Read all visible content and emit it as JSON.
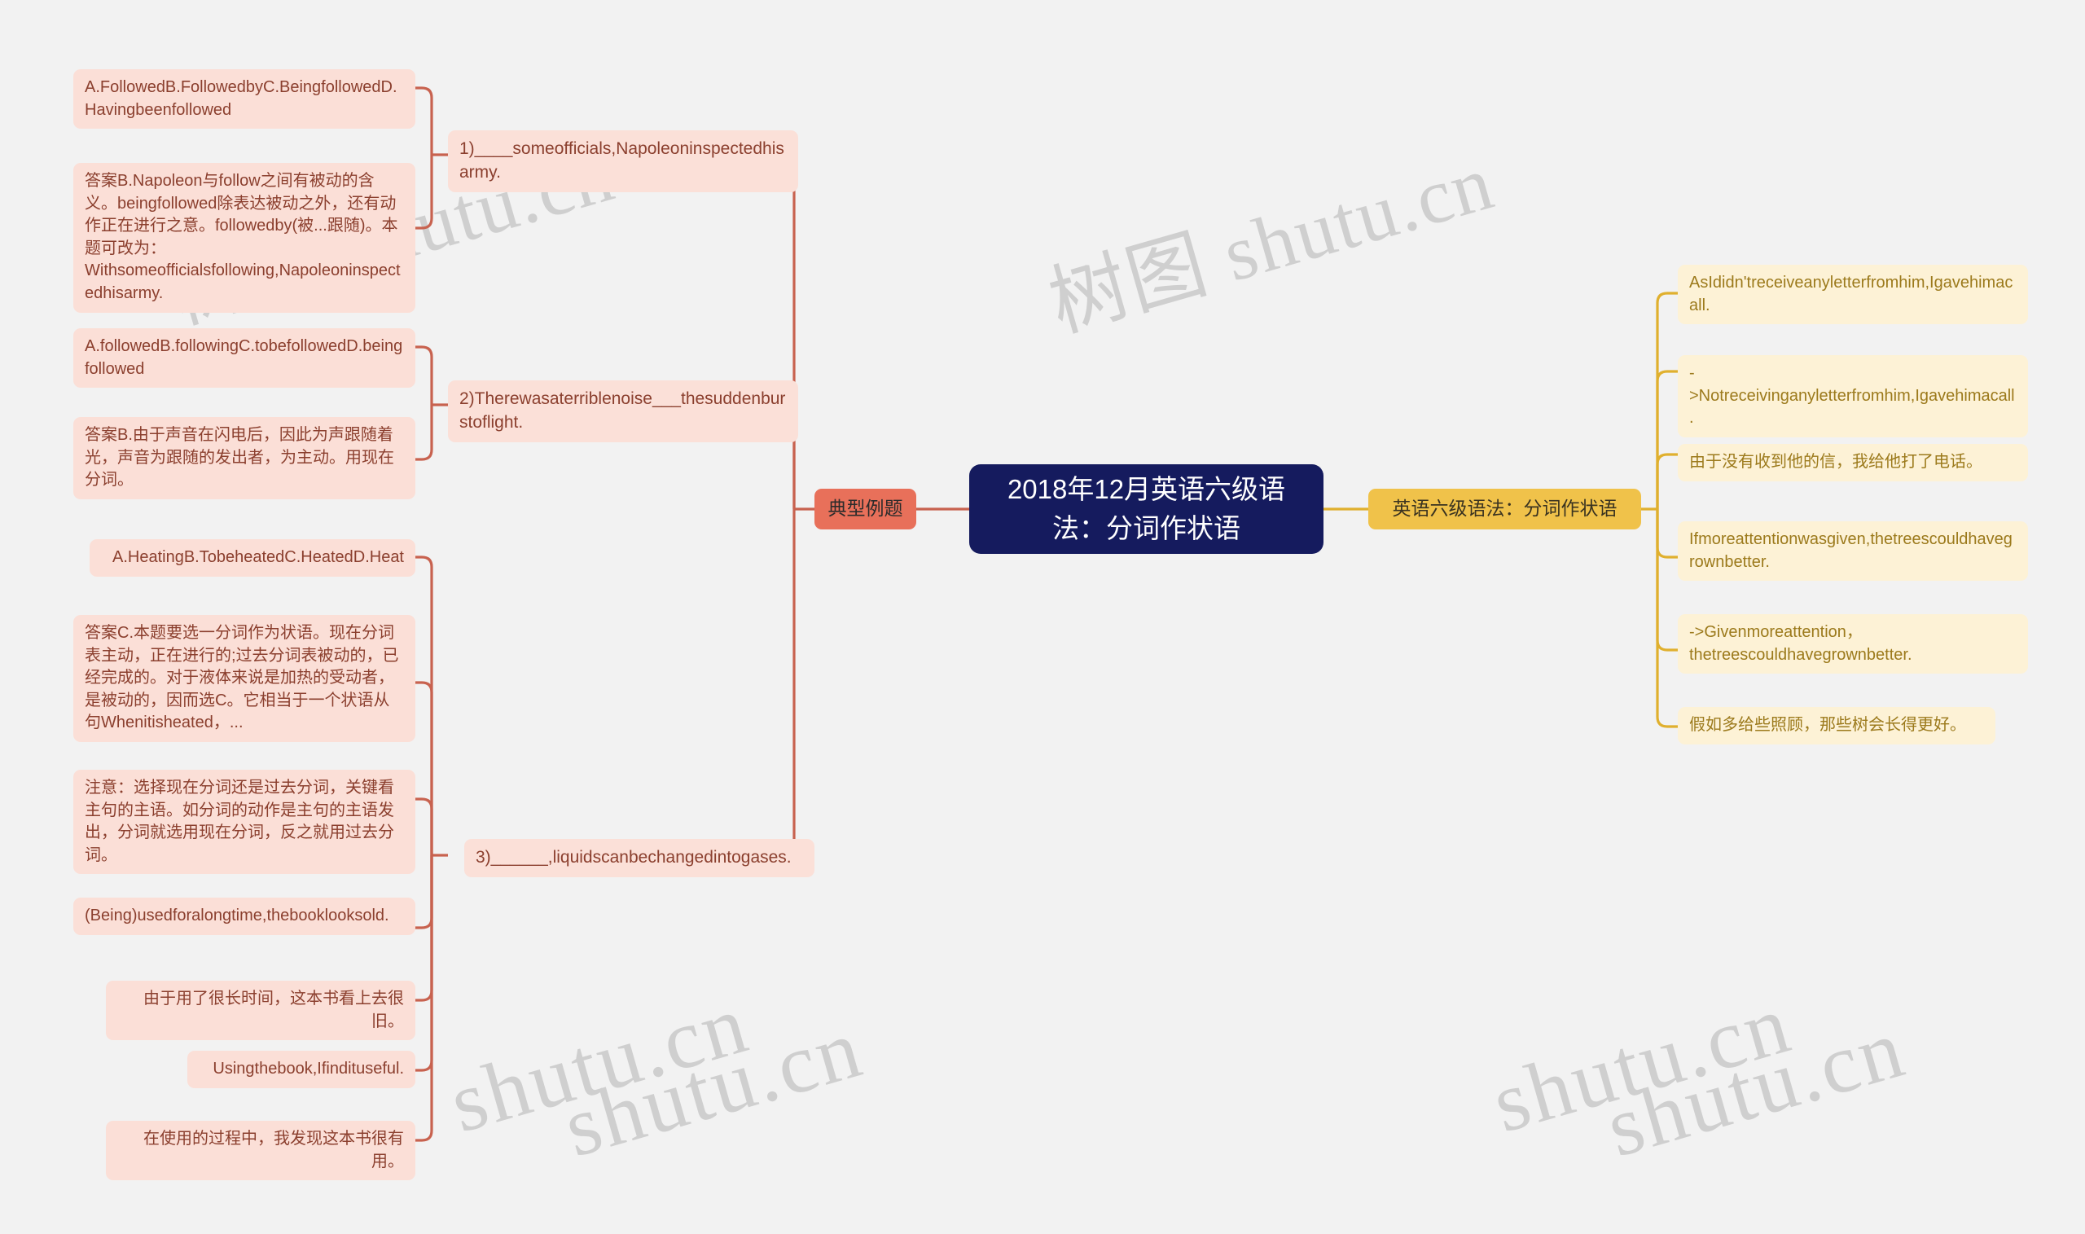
{
  "background": "#f2f2f2",
  "colors": {
    "root_bg": "#151b5e",
    "root_text": "#ffffff",
    "branch_red": "#e8705a",
    "branch_yellow": "#f0c24a",
    "leaf_red_bg": "#fbe0d8",
    "leaf_red_text": "#8b3f2e",
    "leaf_yellow_bg": "#fdf2d6",
    "leaf_yellow_text": "#9c7a1c",
    "link_red": "#c8624f",
    "link_yellow": "#e0b02e"
  },
  "root": {
    "label": "2018年12月英语六级语法：分词作状语"
  },
  "branches": {
    "left": {
      "label": "典型例题"
    },
    "right": {
      "label": "英语六级语法：分词作状语"
    }
  },
  "watermarks": [
    {
      "text": "树图 shutu.cn"
    },
    {
      "text": "树图 shutu.cn"
    },
    {
      "text": "shutu.cn"
    },
    {
      "text": "shutu.cn"
    },
    {
      "text": "shutu.cn"
    },
    {
      "text": "shutu.cn"
    }
  ],
  "left_questions": [
    {
      "stem": "1)____someofficials,Napoleoninspectedhisarmy.",
      "leaves": [
        "A.FollowedB.FollowedbyC.BeingfollowedD.Havingbeenfollowed",
        "答案B.Napoleon与follow之间有被动的含义。beingfollowed除表达被动之外，还有动作正在进行之意。followedby(被...跟随)。本题可改为：Withsomeofficialsfollowing,Napoleoninspectedhisarmy."
      ]
    },
    {
      "stem": "2)Therewasaterriblenoise___thesuddenburstoflight.",
      "leaves": [
        "A.followedB.followingC.tobefollowedD.beingfollowed",
        "答案B.由于声音在闪电后，因此为声跟随着光，声音为跟随的发出者，为主动。用现在分词。"
      ]
    },
    {
      "stem": "3)______,liquidscanbechangedintogases.",
      "leaves": [
        "A.HeatingB.TobeheatedC.HeatedD.Heat",
        "答案C.本题要选一分词作为状语。现在分词表主动，正在进行的;过去分词表被动的，已经完成的。对于液体来说是加热的受动者，是被动的，因而选C。它相当于一个状语从句Whenitisheated，...",
        "注意：选择现在分词还是过去分词，关键看主句的主语。如分词的动作是主句的主语发出，分词就选用现在分词，反之就用过去分词。",
        "(Being)usedforalongtime,thebooklooksold.",
        "由于用了很长时间，这本书看上去很旧。",
        "Usingthebook,Ifindituseful.",
        "在使用的过程中，我发现这本书很有用。"
      ]
    }
  ],
  "right_items": [
    "AsIdidn'treceiveanyletterfromhim,Igavehimacall.",
    "->Notreceivinganyletterfromhim,Igavehimacall.",
    "由于没有收到他的信，我给他打了电话。",
    "Ifmoreattentionwasgiven,thetreescouldhavegrownbetter.",
    "->Givenmoreattention，thetreescouldhavegrownbetter.",
    "假如多给些照顾，那些树会长得更好。"
  ]
}
